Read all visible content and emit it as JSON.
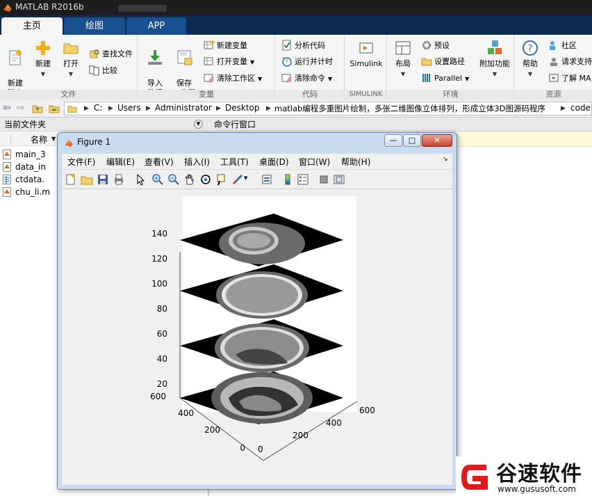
{
  "app": {
    "title": "MATLAB R2016b"
  },
  "tabs": [
    {
      "label": "主页",
      "active": true
    },
    {
      "label": "绘图",
      "active": false
    },
    {
      "label": "APP",
      "active": false
    }
  ],
  "ribbon": {
    "file": {
      "group_label": "文件",
      "new_script": "新建\n脚本",
      "new": "新建",
      "open": "打开",
      "find_files": "查找文件",
      "compare": "比较"
    },
    "variable": {
      "group_label": "变量",
      "import": "导入\n数据",
      "save_workspace": "保存\n工作区",
      "new_var": "新建变量",
      "open_var": "打开变量",
      "clear_workspace": "清除工作区"
    },
    "code": {
      "group_label": "代码",
      "analyze": "分析代码",
      "run_time": "运行并计时",
      "clear_cmd": "清除命令"
    },
    "simulink": {
      "group_label": "SIMULINK",
      "simulink": "Simulink"
    },
    "env": {
      "group_label": "环境",
      "layout": "布局",
      "prefs": "预设",
      "set_path": "设置路径",
      "parallel": "Parallel",
      "addons": "附加功能"
    },
    "resources": {
      "group_label": "资源",
      "help": "帮助",
      "community": "社区",
      "request_support": "请求支持",
      "learn": "了解 MA"
    }
  },
  "address": {
    "crumbs": [
      "C:",
      "Users",
      "Administrator",
      "Desktop",
      "matlab编程多重图片绘制，多张二维图像立体排列，形成立体3D图源码程序",
      "code"
    ]
  },
  "current_folder": {
    "title": "当前文件夹",
    "col_name": "名称",
    "files": [
      "main_3",
      "data_in",
      "ctdata.",
      "chu_li.m"
    ]
  },
  "command_window": {
    "title": "命令行窗口"
  },
  "figure": {
    "title": "Figure 1",
    "menus": [
      "文件(F)",
      "编辑(E)",
      "查看(V)",
      "插入(I)",
      "工具(T)",
      "桌面(D)",
      "窗口(W)",
      "帮助(H)"
    ],
    "buttons": {
      "minimize": "—",
      "maximize": "□",
      "close": "✕"
    }
  },
  "chart_data": {
    "type": "3d-image-stack",
    "zticks": [
      "140",
      "120",
      "100",
      "80",
      "60",
      "40",
      "20"
    ],
    "yticks": [
      "600",
      "400",
      "200",
      "0"
    ],
    "xticks": [
      "0",
      "200",
      "400",
      "600"
    ],
    "slices": [
      {
        "z": 20,
        "content": "CT slice (brain base)"
      },
      {
        "z": 60,
        "content": "CT slice (skull)"
      },
      {
        "z": 100,
        "content": "CT slice (cranium)"
      },
      {
        "z": 140,
        "content": "CT slice (top)"
      }
    ]
  },
  "watermark": {
    "brand": "谷速软件",
    "url": "www.gususoft.com"
  }
}
